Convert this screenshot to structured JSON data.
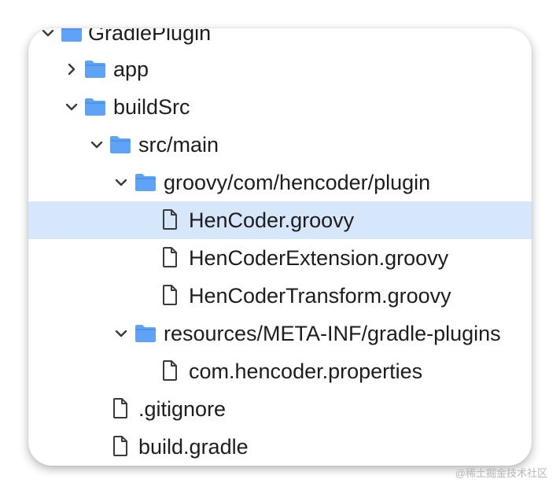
{
  "tree": {
    "root": {
      "label": "GradlePlugin",
      "expanded": true
    },
    "items": [
      {
        "label": "app",
        "type": "folder",
        "expanded": false
      },
      {
        "label": "buildSrc",
        "type": "folder",
        "expanded": true
      },
      {
        "label": "src/main",
        "type": "folder",
        "expanded": true
      },
      {
        "label": "groovy/com/hencoder/plugin",
        "type": "folder",
        "expanded": true
      },
      {
        "label": "HenCoder.groovy",
        "type": "file",
        "selected": true
      },
      {
        "label": "HenCoderExtension.groovy",
        "type": "file"
      },
      {
        "label": "HenCoderTransform.groovy",
        "type": "file"
      },
      {
        "label": "resources/META-INF/gradle-plugins",
        "type": "folder",
        "expanded": true
      },
      {
        "label": "com.hencoder.properties",
        "type": "file"
      },
      {
        "label": ".gitignore",
        "type": "file"
      },
      {
        "label": "build.gradle",
        "type": "file"
      }
    ]
  },
  "colors": {
    "folder": "#5ea3f7",
    "selection": "#d6e6fb",
    "text": "#1d1d1f",
    "chevron": "#3a3a3c"
  },
  "icons": {
    "folder": "folder-icon",
    "file": "document-icon",
    "expanded": "chevron-down-icon",
    "collapsed": "chevron-right-icon"
  },
  "watermark": "@稀土掘金技术社区"
}
